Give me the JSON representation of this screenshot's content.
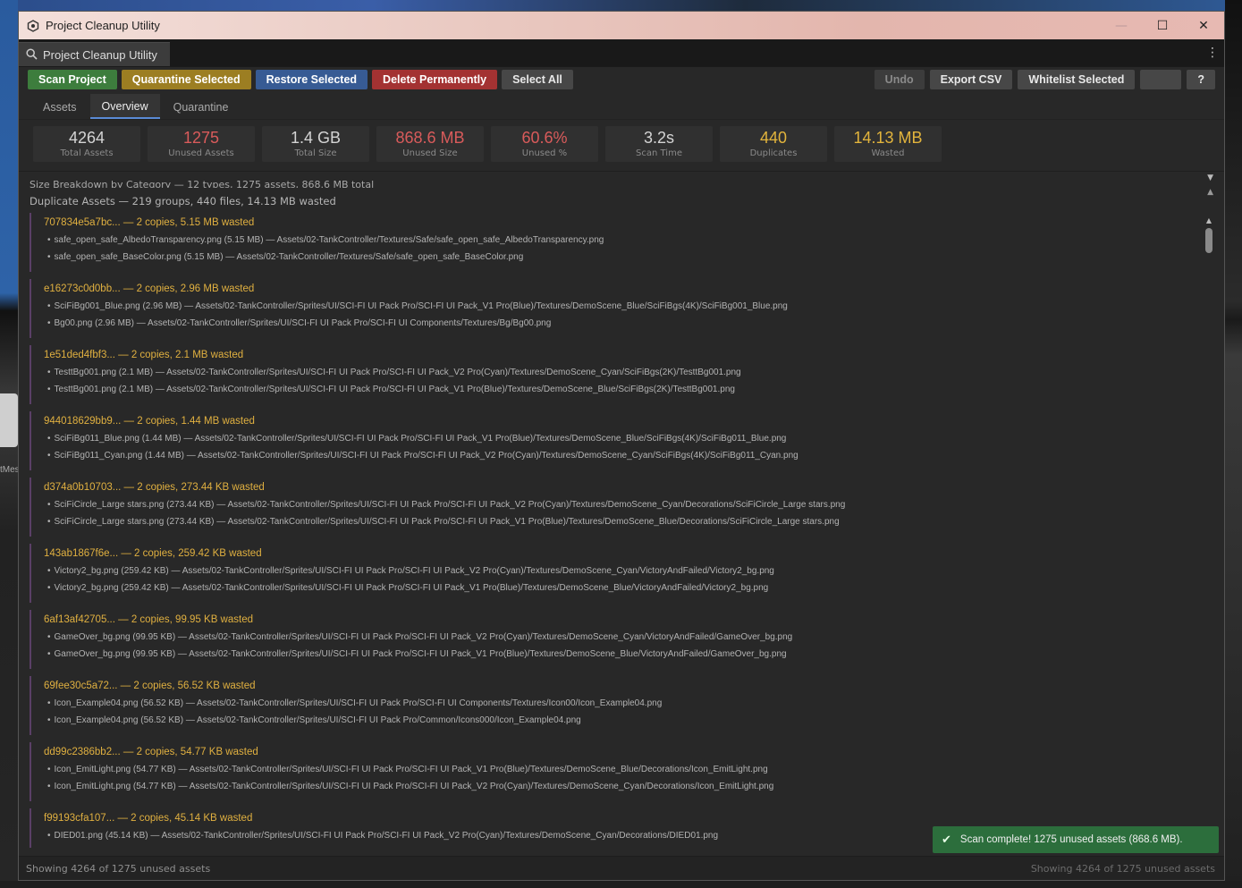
{
  "window": {
    "title": "Project Cleanup Utility",
    "tab_title": "Project Cleanup Utility",
    "controls": {
      "minimize": "—",
      "maximize": "☐",
      "close": "✕"
    }
  },
  "background": {
    "label": "tMes"
  },
  "toolbar": {
    "left": [
      {
        "label": "Scan Project",
        "color": "#3d7d3d"
      },
      {
        "label": "Quarantine Selected",
        "color": "#9c7e22"
      },
      {
        "label": "Restore Selected",
        "color": "#375b94"
      },
      {
        "label": "Delete Permanently",
        "color": "#a33232"
      },
      {
        "label": "Select All",
        "color": "#474747"
      }
    ],
    "right": {
      "undo": "Undo",
      "export_csv": "Export CSV",
      "whitelist": "Whitelist Selected",
      "blank": "",
      "help": "?"
    }
  },
  "tabs": {
    "assets": "Assets",
    "overview": "Overview",
    "quarantine": "Quarantine",
    "active": "Overview"
  },
  "stats": [
    {
      "value": "4264",
      "label": "Total Assets",
      "color": "#d4d4d4"
    },
    {
      "value": "1275",
      "label": "Unused Assets",
      "color": "#d95b5b"
    },
    {
      "value": "1.4 GB",
      "label": "Total Size",
      "color": "#d4d4d4"
    },
    {
      "value": "868.6 MB",
      "label": "Unused Size",
      "color": "#d95b5b"
    },
    {
      "value": "60.6%",
      "label": "Unused %",
      "color": "#d95b5b"
    },
    {
      "value": "3.2s",
      "label": "Scan Time",
      "color": "#d4d4d4"
    },
    {
      "value": "440",
      "label": "Duplicates",
      "color": "#e2b43c"
    },
    {
      "value": "14.13 MB",
      "label": "Wasted",
      "color": "#e2b43c"
    }
  ],
  "sections": {
    "size_breakdown": "Size Breakdown by Category — 12 types, 1275 assets, 868.6 MB total",
    "duplicates": "Duplicate Assets — 219 groups, 440 files, 14.13 MB wasted"
  },
  "groups": [
    {
      "header": "707834e5a7bc... — 2 copies, 5.15 MB wasted",
      "files": [
        "safe_open_safe_AlbedoTransparency.png (5.15 MB) — Assets/02-TankController/Textures/Safe/safe_open_safe_AlbedoTransparency.png",
        "safe_open_safe_BaseColor.png (5.15 MB) — Assets/02-TankController/Textures/Safe/safe_open_safe_BaseColor.png"
      ]
    },
    {
      "header": "e16273c0d0bb... — 2 copies, 2.96 MB wasted",
      "files": [
        "SciFiBg001_Blue.png (2.96 MB) — Assets/02-TankController/Sprites/UI/SCI-FI UI Pack Pro/SCI-FI UI Pack_V1 Pro(Blue)/Textures/DemoScene_Blue/SciFiBgs(4K)/SciFiBg001_Blue.png",
        "Bg00.png (2.96 MB) — Assets/02-TankController/Sprites/UI/SCI-FI UI Pack Pro/SCI-FI UI Components/Textures/Bg/Bg00.png"
      ]
    },
    {
      "header": "1e51ded4fbf3... — 2 copies, 2.1 MB wasted",
      "files": [
        "TesttBg001.png (2.1 MB) — Assets/02-TankController/Sprites/UI/SCI-FI UI Pack Pro/SCI-FI UI Pack_V2 Pro(Cyan)/Textures/DemoScene_Cyan/SciFiBgs(2K)/TesttBg001.png",
        "TesttBg001.png (2.1 MB) — Assets/02-TankController/Sprites/UI/SCI-FI UI Pack Pro/SCI-FI UI Pack_V1 Pro(Blue)/Textures/DemoScene_Blue/SciFiBgs(2K)/TesttBg001.png"
      ]
    },
    {
      "header": "944018629bb9... — 2 copies, 1.44 MB wasted",
      "files": [
        "SciFiBg011_Blue.png (1.44 MB) — Assets/02-TankController/Sprites/UI/SCI-FI UI Pack Pro/SCI-FI UI Pack_V1 Pro(Blue)/Textures/DemoScene_Blue/SciFiBgs(4K)/SciFiBg011_Blue.png",
        "SciFiBg011_Cyan.png (1.44 MB) — Assets/02-TankController/Sprites/UI/SCI-FI UI Pack Pro/SCI-FI UI Pack_V2 Pro(Cyan)/Textures/DemoScene_Cyan/SciFiBgs(4K)/SciFiBg011_Cyan.png"
      ]
    },
    {
      "header": "d374a0b10703... — 2 copies, 273.44 KB wasted",
      "files": [
        "SciFiCircle_Large stars.png (273.44 KB) — Assets/02-TankController/Sprites/UI/SCI-FI UI Pack Pro/SCI-FI UI Pack_V2 Pro(Cyan)/Textures/DemoScene_Cyan/Decorations/SciFiCircle_Large stars.png",
        "SciFiCircle_Large stars.png (273.44 KB) — Assets/02-TankController/Sprites/UI/SCI-FI UI Pack Pro/SCI-FI UI Pack_V1 Pro(Blue)/Textures/DemoScene_Blue/Decorations/SciFiCircle_Large stars.png"
      ]
    },
    {
      "header": "143ab1867f6e... — 2 copies, 259.42 KB wasted",
      "files": [
        "Victory2_bg.png (259.42 KB) — Assets/02-TankController/Sprites/UI/SCI-FI UI Pack Pro/SCI-FI UI Pack_V2 Pro(Cyan)/Textures/DemoScene_Cyan/VictoryAndFailed/Victory2_bg.png",
        "Victory2_bg.png (259.42 KB) — Assets/02-TankController/Sprites/UI/SCI-FI UI Pack Pro/SCI-FI UI Pack_V1 Pro(Blue)/Textures/DemoScene_Blue/VictoryAndFailed/Victory2_bg.png"
      ]
    },
    {
      "header": "6af13af42705... — 2 copies, 99.95 KB wasted",
      "files": [
        "GameOver_bg.png (99.95 KB) — Assets/02-TankController/Sprites/UI/SCI-FI UI Pack Pro/SCI-FI UI Pack_V2 Pro(Cyan)/Textures/DemoScene_Cyan/VictoryAndFailed/GameOver_bg.png",
        "GameOver_bg.png (99.95 KB) — Assets/02-TankController/Sprites/UI/SCI-FI UI Pack Pro/SCI-FI UI Pack_V1 Pro(Blue)/Textures/DemoScene_Blue/VictoryAndFailed/GameOver_bg.png"
      ]
    },
    {
      "header": "69fee30c5a72... — 2 copies, 56.52 KB wasted",
      "files": [
        "Icon_Example04.png (56.52 KB) — Assets/02-TankController/Sprites/UI/SCI-FI UI Pack Pro/SCI-FI UI Components/Textures/Icon00/Icon_Example04.png",
        "Icon_Example04.png (56.52 KB) — Assets/02-TankController/Sprites/UI/SCI-FI UI Pack Pro/Common/Icons000/Icon_Example04.png"
      ]
    },
    {
      "header": "dd99c2386bb2... — 2 copies, 54.77 KB wasted",
      "files": [
        "Icon_EmitLight.png (54.77 KB) — Assets/02-TankController/Sprites/UI/SCI-FI UI Pack Pro/SCI-FI UI Pack_V1 Pro(Blue)/Textures/DemoScene_Blue/Decorations/Icon_EmitLight.png",
        "Icon_EmitLight.png (54.77 KB) — Assets/02-TankController/Sprites/UI/SCI-FI UI Pack Pro/SCI-FI UI Pack_V2 Pro(Cyan)/Textures/DemoScene_Cyan/Decorations/Icon_EmitLight.png"
      ]
    },
    {
      "header": "f99193cfa107... — 2 copies, 45.14 KB wasted",
      "files": [
        "DIED01.png (45.14 KB) — Assets/02-TankController/Sprites/UI/SCI-FI UI Pack Pro/SCI-FI UI Pack_V2 Pro(Cyan)/Textures/DemoScene_Cyan/Decorations/DIED01.png"
      ]
    }
  ],
  "toast": {
    "icon": "✔",
    "message": "Scan complete! 1275 unused assets (868.6 MB)."
  },
  "status": {
    "left": "Showing 4264 of 1275 unused assets",
    "right": "Showing 4264 of 1275 unused assets"
  },
  "colors": {
    "accent": "#5a8bd6",
    "group_header": "#e0b040",
    "toast": "#2c6e3c"
  }
}
